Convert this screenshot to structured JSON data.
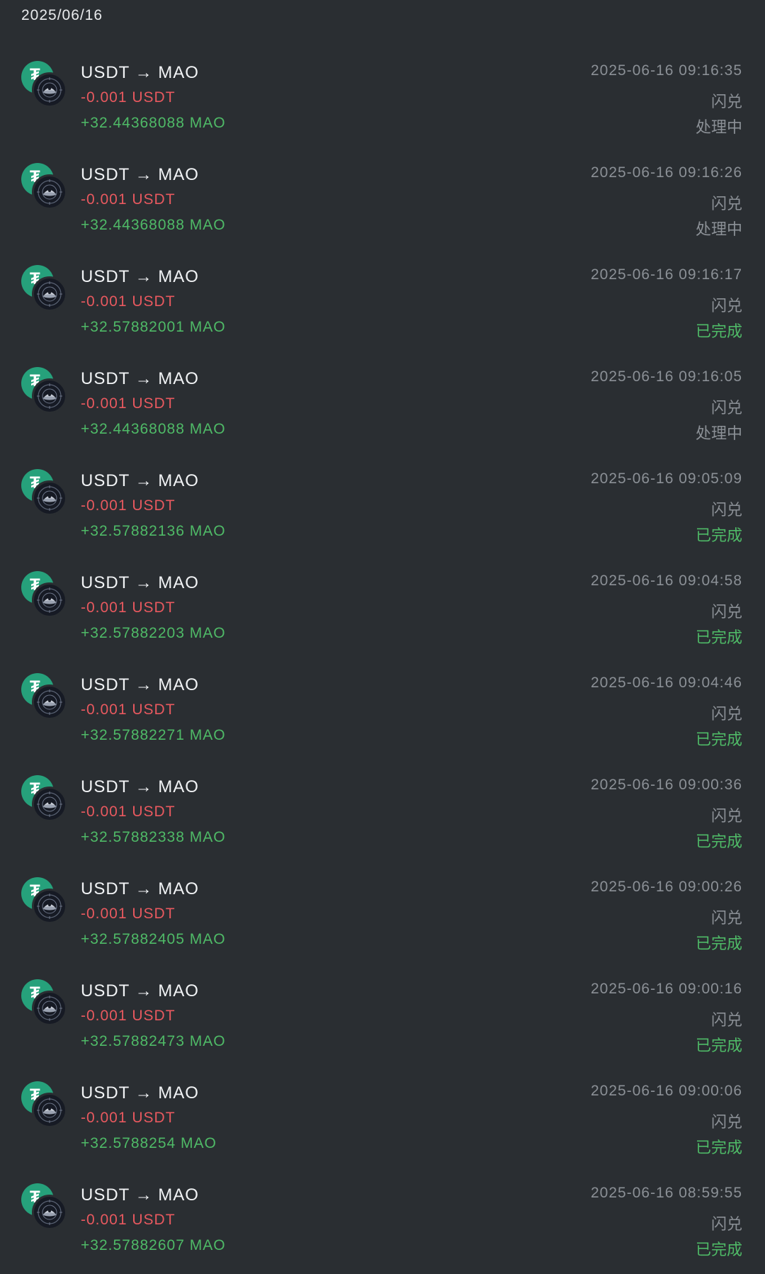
{
  "date_header": "2025/06/16",
  "colors": {
    "background": "#2a2e32",
    "negative": "#e8595f",
    "positive": "#4fba67",
    "muted": "#8b9096",
    "usdt_brand": "#26a17b"
  },
  "icons": {
    "from_token": "usdt-icon",
    "to_token": "mao-icon"
  },
  "transactions": [
    {
      "pair": "USDT → MAO",
      "out": "-0.001 USDT",
      "in": "+32.44368088 MAO",
      "time": "2025-06-16 09:16:35",
      "type": "闪兑",
      "status": "处理中",
      "status_kind": "pending"
    },
    {
      "pair": "USDT → MAO",
      "out": "-0.001 USDT",
      "in": "+32.44368088 MAO",
      "time": "2025-06-16 09:16:26",
      "type": "闪兑",
      "status": "处理中",
      "status_kind": "pending"
    },
    {
      "pair": "USDT → MAO",
      "out": "-0.001 USDT",
      "in": "+32.57882001 MAO",
      "time": "2025-06-16 09:16:17",
      "type": "闪兑",
      "status": "已完成",
      "status_kind": "done"
    },
    {
      "pair": "USDT → MAO",
      "out": "-0.001 USDT",
      "in": "+32.44368088 MAO",
      "time": "2025-06-16 09:16:05",
      "type": "闪兑",
      "status": "处理中",
      "status_kind": "pending"
    },
    {
      "pair": "USDT → MAO",
      "out": "-0.001 USDT",
      "in": "+32.57882136 MAO",
      "time": "2025-06-16 09:05:09",
      "type": "闪兑",
      "status": "已完成",
      "status_kind": "done"
    },
    {
      "pair": "USDT → MAO",
      "out": "-0.001 USDT",
      "in": "+32.57882203 MAO",
      "time": "2025-06-16 09:04:58",
      "type": "闪兑",
      "status": "已完成",
      "status_kind": "done"
    },
    {
      "pair": "USDT → MAO",
      "out": "-0.001 USDT",
      "in": "+32.57882271 MAO",
      "time": "2025-06-16 09:04:46",
      "type": "闪兑",
      "status": "已完成",
      "status_kind": "done"
    },
    {
      "pair": "USDT → MAO",
      "out": "-0.001 USDT",
      "in": "+32.57882338 MAO",
      "time": "2025-06-16 09:00:36",
      "type": "闪兑",
      "status": "已完成",
      "status_kind": "done"
    },
    {
      "pair": "USDT → MAO",
      "out": "-0.001 USDT",
      "in": "+32.57882405 MAO",
      "time": "2025-06-16 09:00:26",
      "type": "闪兑",
      "status": "已完成",
      "status_kind": "done"
    },
    {
      "pair": "USDT → MAO",
      "out": "-0.001 USDT",
      "in": "+32.57882473 MAO",
      "time": "2025-06-16 09:00:16",
      "type": "闪兑",
      "status": "已完成",
      "status_kind": "done"
    },
    {
      "pair": "USDT → MAO",
      "out": "-0.001 USDT",
      "in": "+32.5788254 MAO",
      "time": "2025-06-16 09:00:06",
      "type": "闪兑",
      "status": "已完成",
      "status_kind": "done"
    },
    {
      "pair": "USDT → MAO",
      "out": "-0.001 USDT",
      "in": "+32.57882607 MAO",
      "time": "2025-06-16 08:59:55",
      "type": "闪兑",
      "status": "已完成",
      "status_kind": "done"
    }
  ]
}
